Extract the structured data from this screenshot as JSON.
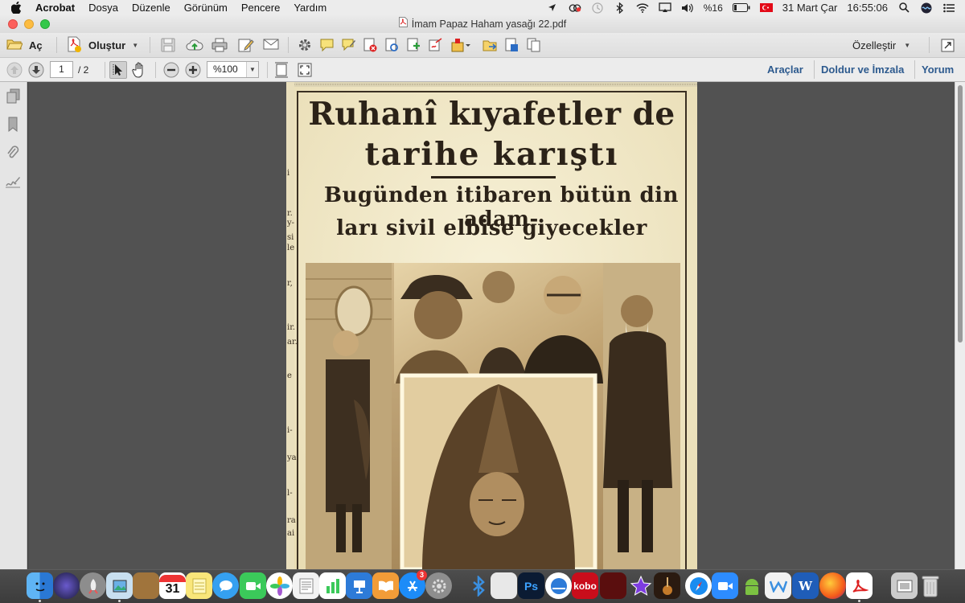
{
  "menubar": {
    "app": "Acrobat",
    "items": [
      "Dosya",
      "Düzenle",
      "Görünüm",
      "Pencere",
      "Yardım"
    ],
    "battery": "%16",
    "date": "31 Mart Çar",
    "time": "16:55:06"
  },
  "window": {
    "title": "İmam Papaz Haham yasağı 22.pdf"
  },
  "toolbar": {
    "open_label": "Aç",
    "create_label": "Oluştur",
    "customize_label": "Özelleştir"
  },
  "navbar": {
    "current_page": "1",
    "total_pages": "/ 2",
    "zoom": "%100",
    "tools_link": "Araçlar",
    "fill_sign_link": "Doldur ve İmzala",
    "comment_link": "Yorum"
  },
  "document": {
    "headline_line1": "Ruhanî kıyafetler de",
    "headline_line2": "tarihe karıştı",
    "subheadline_line1": "Bugünden itibaren bütün din adam-",
    "subheadline_line2": "ları sivil elbise giyecekler",
    "edge_fragments": [
      "i",
      "r.",
      "y-",
      "si",
      "le",
      "r,",
      "ir.",
      "ar.",
      "e",
      "i-",
      "ya",
      "l-",
      "ra",
      "ai"
    ]
  },
  "dock": {
    "calendar_day": "31",
    "kobo_label": "kobo",
    "ps_label": "Ps",
    "word_label": "W",
    "appstore_badge": "3"
  },
  "colors": {
    "paper": "#f3ecd0",
    "ink": "#2b2218",
    "link": "#2d5a8e"
  }
}
